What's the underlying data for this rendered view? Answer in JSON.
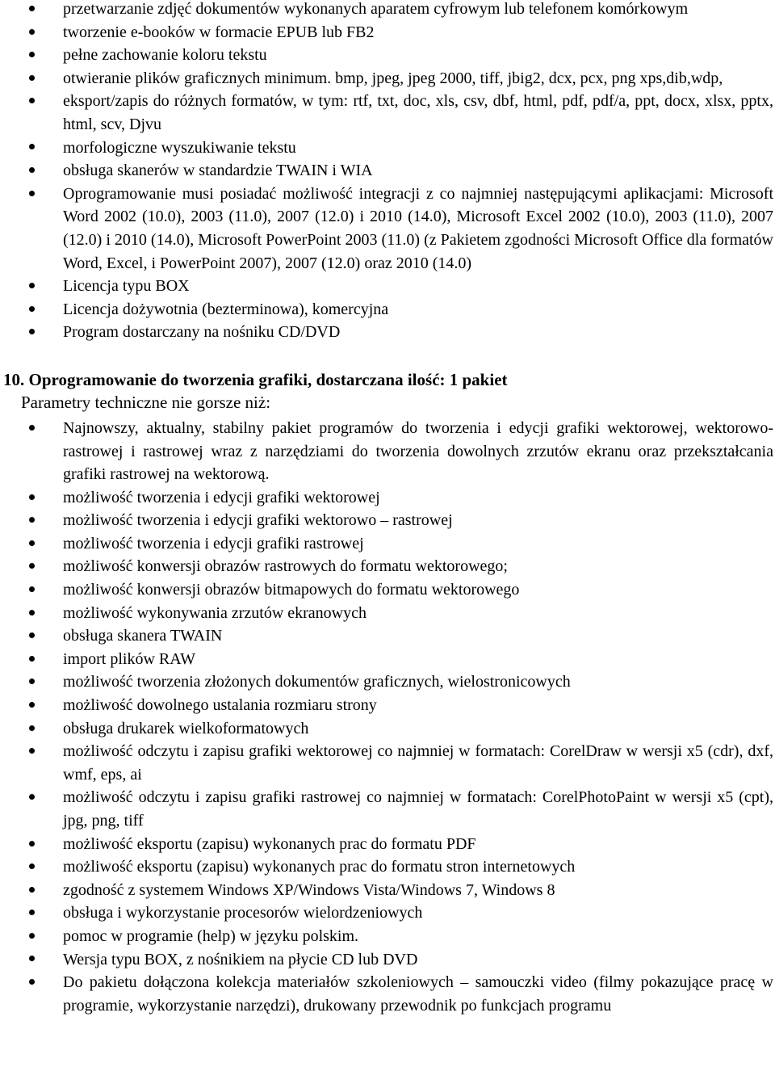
{
  "list1": {
    "items": [
      "przetwarzanie zdjęć dokumentów wykonanych aparatem cyfrowym lub telefonem komórkowym",
      "tworzenie e-booków w formacie EPUB lub FB2",
      "pełne zachowanie koloru tekstu",
      "otwieranie plików graficznych minimum. bmp, jpeg, jpeg 2000, tiff,  jbig2, dcx, pcx, png xps,dib,wdp,",
      "eksport/zapis do różnych formatów, w tym: rtf, txt, doc, xls, csv, dbf, html, pdf, pdf/a, ppt, docx, xlsx, pptx, html, scv, Djvu",
      "morfologiczne wyszukiwanie tekstu",
      "obsługa skanerów w standardzie TWAIN i WIA",
      "Oprogramowanie musi posiadać możliwość integracji z co najmniej następującymi aplikacjami: Microsoft Word 2002 (10.0), 2003 (11.0), 2007 (12.0) i 2010 (14.0), Microsoft Excel 2002 (10.0), 2003 (11.0), 2007 (12.0) i 2010 (14.0), Microsoft PowerPoint 2003 (11.0) (z Pakietem zgodności Microsoft Office dla formatów Word, Excel, i PowerPoint 2007), 2007 (12.0) oraz 2010 (14.0)",
      "Licencja typu BOX",
      "Licencja dożywotnia (bezterminowa), komercyjna",
      "Program dostarczany na nośniku CD/DVD"
    ]
  },
  "section10": {
    "heading": "10. Oprogramowanie do tworzenia grafiki, dostarczana ilość: 1 pakiet",
    "subtitle": "Parametry techniczne nie gorsze niż:",
    "items": [
      "Najnowszy, aktualny, stabilny pakiet programów do tworzenia i edycji grafiki wektorowej, wektorowo-rastrowej i rastrowej wraz z narzędziami do tworzenia dowolnych zrzutów ekranu oraz przekształcania grafiki rastrowej na wektorową.",
      "możliwość tworzenia i edycji grafiki wektorowej",
      "możliwość tworzenia i edycji grafiki wektorowo – rastrowej",
      "możliwość tworzenia i edycji grafiki rastrowej",
      "możliwość konwersji obrazów rastrowych do formatu wektorowego;",
      "możliwość konwersji obrazów bitmapowych do formatu wektorowego",
      "możliwość wykonywania zrzutów ekranowych",
      "obsługa skanera TWAIN",
      "import plików RAW",
      "możliwość tworzenia złożonych dokumentów graficznych, wielostronicowych",
      "możliwość dowolnego ustalania rozmiaru strony",
      "obsługa drukarek wielkoformatowych",
      "możliwość odczytu i zapisu grafiki wektorowej co najmniej w formatach: CorelDraw w wersji x5 (cdr), dxf, wmf, eps, ai",
      "możliwość odczytu i zapisu grafiki rastrowej co najmniej w formatach: CorelPhotoPaint w wersji x5 (cpt), jpg, png, tiff",
      "możliwość eksportu (zapisu) wykonanych prac do formatu PDF",
      "możliwość eksportu (zapisu) wykonanych prac do formatu stron internetowych",
      "zgodność z systemem Windows XP/Windows Vista/Windows 7, Windows 8",
      "obsługa i wykorzystanie procesorów wielordzeniowych",
      "pomoc w programie (help) w języku polskim.",
      "Wersja typu BOX, z nośnikiem na płycie CD lub DVD",
      "Do pakietu dołączona kolekcja materiałów szkoleniowych – samouczki video (filmy pokazujące pracę w programie, wykorzystanie narzędzi), drukowany przewodnik po funkcjach programu"
    ]
  }
}
